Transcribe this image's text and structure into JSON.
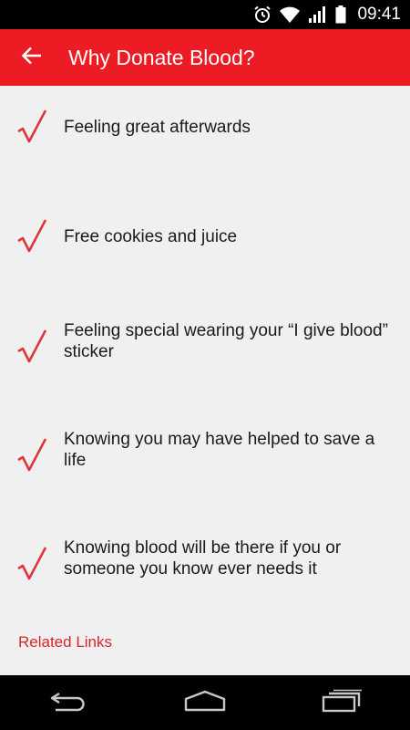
{
  "status_bar": {
    "time": "09:41",
    "icons": [
      "alarm-icon",
      "wifi-icon",
      "signal-icon",
      "battery-icon"
    ]
  },
  "app_bar": {
    "title": "Why Donate Blood?",
    "back_icon": "back-arrow-icon"
  },
  "reasons": [
    {
      "text": "Feeling great afterwards"
    },
    {
      "text": "Free cookies and juice"
    },
    {
      "text": "Feeling special wearing your “I give blood” sticker"
    },
    {
      "text": "Knowing you may have helped to save a life"
    },
    {
      "text": "Knowing blood will be there if you or someone you know ever needs it"
    }
  ],
  "related_links": {
    "label": "Related Links"
  },
  "nav_bar": {
    "icons": [
      "nav-back-icon",
      "nav-home-icon",
      "nav-recents-icon"
    ]
  },
  "colors": {
    "brand_red": "#ed1c24",
    "check_red": "#e0353b",
    "link_red": "#d9262d",
    "background": "#f0f0f0"
  }
}
